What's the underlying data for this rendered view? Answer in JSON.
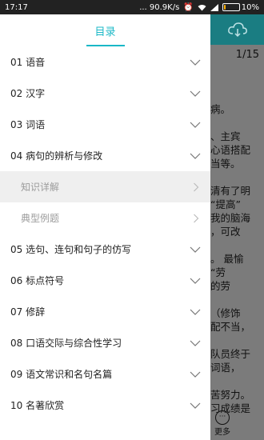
{
  "status_bar": {
    "time": "17:17",
    "network_speed": "... 90.9K/s",
    "battery_percent": "10%",
    "battery_level": 0.1
  },
  "drawer": {
    "title": "目录",
    "items": [
      {
        "label": "01 语音"
      },
      {
        "label": "02 汉字"
      },
      {
        "label": "03 词语"
      },
      {
        "label": "04 病句的辨析与修改",
        "expanded": true,
        "children": [
          {
            "label": "知识详解"
          },
          {
            "label": "典型例题"
          }
        ]
      },
      {
        "label": "05 选句、连句和句子的仿写"
      },
      {
        "label": "06 标点符号"
      },
      {
        "label": "07 修辞"
      },
      {
        "label": "08 口语交际与综合性学习"
      },
      {
        "label": "09 语文常识和名句名篇"
      },
      {
        "label": "10 名著欣赏"
      }
    ]
  },
  "background_page": {
    "page_indicator": "1/15",
    "visible_text": "病。\n\n、主宾\n心语搭配\n当等。\n\n清有了明\n“提高”\n我的脑海\n，可改\n\n。 最愉\n“劳\n的劳\n\n（修饰\n配不当，\n\n队员终于\n词语，\n\n苦努力。\n习成绩是",
    "more_label": "更多",
    "colors": {
      "header": "#1a7d82",
      "overlay": "#7b7b7b"
    }
  },
  "colors": {
    "accent": "#1ab8c7"
  }
}
